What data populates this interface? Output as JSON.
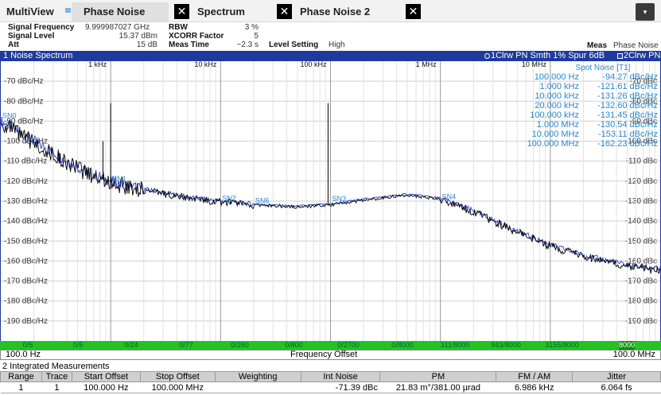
{
  "tabs": {
    "app": "MultiView",
    "items": [
      {
        "label": "Phase Noise",
        "active": true
      },
      {
        "label": "Spectrum",
        "active": false
      },
      {
        "label": "Phase Noise 2",
        "active": false
      }
    ],
    "close_glyph": "✕",
    "dropdown_glyph": "▾"
  },
  "settings": {
    "signal_frequency_label": "Signal Frequency",
    "signal_frequency_value": "9.999987027 GHz",
    "signal_level_label": "Signal Level",
    "signal_level_value": "15.37 dBm",
    "att_label": "Att",
    "att_value": "15 dB",
    "rbw_label": "RBW",
    "rbw_value": "3 %",
    "xcorr_label": "XCORR Factor",
    "xcorr_value": "5",
    "meas_time_label": "Meas Time",
    "meas_time_value": "~2.3 s",
    "level_setting_label": "Level Setting",
    "level_setting_value": "High",
    "meas_label": "Meas",
    "meas_value": "Phase Noise"
  },
  "diagram": {
    "title": "1 Noise Spectrum",
    "trace_info_1": "1Clrw PN Smth 1% Spur 6dB",
    "trace_info_2": "2Clrw PN",
    "trace1_color": "#000000",
    "trace2_color": "#2a3fc4",
    "start_freq": "100.0 Hz",
    "stop_freq": "100.0 MHz",
    "axis_label": "Frequency Offset"
  },
  "chart_data": {
    "type": "line",
    "title": "1 Noise Spectrum",
    "xlabel": "Frequency Offset",
    "ylabel": "dBc/Hz",
    "x_scale": "log",
    "xlim_hz": [
      100,
      100000000
    ],
    "ylim": [
      -200,
      -60
    ],
    "grid": true,
    "decade_labels": [
      {
        "hz": 1000,
        "label": "1 kHz"
      },
      {
        "hz": 10000,
        "label": "10 kHz"
      },
      {
        "hz": 100000,
        "label": "100 kHz"
      },
      {
        "hz": 1000000,
        "label": "1 MHz"
      },
      {
        "hz": 10000000,
        "label": "10 MHz"
      }
    ],
    "y_ticks": [
      -70,
      -80,
      -90,
      -100,
      -110,
      -120,
      -130,
      -140,
      -150,
      -160,
      -170,
      -180,
      -190
    ],
    "y_tick_unit": "dBc/Hz",
    "series": [
      {
        "name": "2Clrw PN",
        "color": "#2a3fc4",
        "x": [
          100,
          200,
          500,
          1000,
          2000,
          5000,
          10000,
          20000,
          50000,
          100000,
          200000,
          500000,
          1000000,
          2000000,
          5000000,
          10000000,
          20000000,
          50000000,
          100000000
        ],
        "y": [
          -90,
          -100,
          -113,
          -120,
          -124,
          -128,
          -130,
          -131.5,
          -132.5,
          -131.5,
          -129,
          -126.5,
          -128.5,
          -135,
          -145,
          -152,
          -157,
          -162,
          -164
        ]
      },
      {
        "name": "1Clrw PN Smth 1% Spur 6dB",
        "color": "#000000",
        "x": [
          100,
          200,
          500,
          1000,
          2000,
          5000,
          10000,
          20000,
          50000,
          100000,
          200000,
          500000,
          1000000,
          2000000,
          5000000,
          10000000,
          20000000,
          50000000,
          100000000
        ],
        "y": [
          -91,
          -101,
          -114,
          -121,
          -124.5,
          -128.5,
          -130.5,
          -132,
          -133,
          -132,
          -129.5,
          -127,
          -129,
          -135.5,
          -145.5,
          -152.5,
          -157.5,
          -162.5,
          -165
        ]
      }
    ],
    "spurs": [
      {
        "hz": 1000,
        "y": -81
      },
      {
        "hz": 850,
        "y": -100
      },
      {
        "hz": 95000,
        "y": -81
      }
    ],
    "spot_markers": [
      {
        "label": "SN0",
        "hz": 100,
        "y": -90
      },
      {
        "label": "SN1",
        "hz": 1000,
        "y": -121.6
      },
      {
        "label": "SN2",
        "hz": 10000,
        "y": -131.3
      },
      {
        "label": "SN6",
        "hz": 20000,
        "y": -132.6
      },
      {
        "label": "SN3",
        "hz": 100000,
        "y": -131.5
      },
      {
        "label": "SN4",
        "hz": 1000000,
        "y": -130.5
      }
    ]
  },
  "spot_noise": {
    "title": "Spot Noise [T1]",
    "rows": [
      {
        "freq": "100.000 Hz",
        "value": "-94.27 dBc/Hz"
      },
      {
        "freq": "1.000 kHz",
        "value": "-121.61 dBc/Hz"
      },
      {
        "freq": "10.000 kHz",
        "value": "-131.26 dBc/Hz"
      },
      {
        "freq": "20.000 kHz",
        "value": "-132.60 dBc/Hz"
      },
      {
        "freq": "100.000 kHz",
        "value": "-131.45 dBc/Hz"
      },
      {
        "freq": "1.000 MHz",
        "value": "-130.54 dBc/Hz"
      },
      {
        "freq": "10.000 MHz",
        "value": "-153.11 dBc/Hz"
      },
      {
        "freq": "100.000 MHz",
        "value": "-162.23 dBc/Hz"
      }
    ]
  },
  "bottom_bar": {
    "color": "#22c322",
    "segments": [
      "0/5",
      "0/5",
      "0/24",
      "0/77",
      "0/260",
      "0/800",
      "0/2700",
      "0/8000",
      "311/8000",
      "943/8000",
      "3155/8000",
      "8000"
    ]
  },
  "integrated": {
    "title": "2 Integrated Measurements",
    "headers": [
      "Range",
      "Trace",
      "Start Offset",
      "Stop Offset",
      "Weighting",
      "Int Noise",
      "PM",
      "FM / AM",
      "Jitter"
    ],
    "rows": [
      [
        "1",
        "1",
        "100.000 Hz",
        "100.000 MHz",
        "",
        "-71.39 dBc",
        "21.83 m°/381.00 µrad",
        "6.986 kHz",
        "6.064 fs"
      ]
    ]
  }
}
